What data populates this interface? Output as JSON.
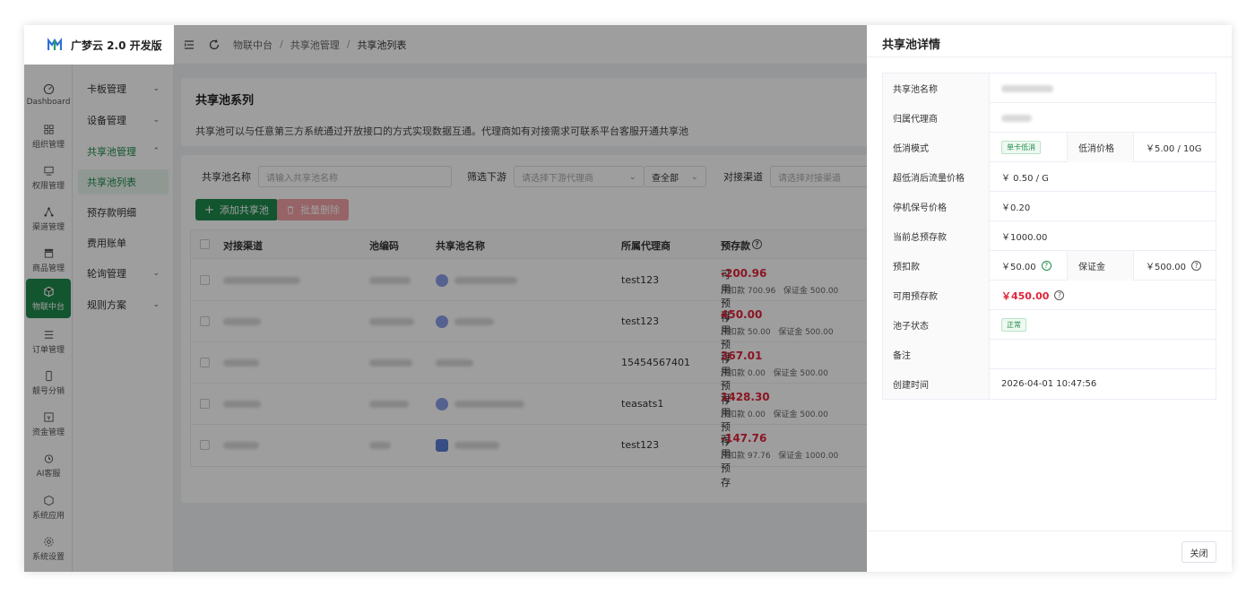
{
  "app": {
    "name": "广梦云 2.0 开发版"
  },
  "rail": [
    {
      "label": "Dashboard",
      "icon": "dashboard-icon"
    },
    {
      "label": "组织管理",
      "icon": "grid-icon"
    },
    {
      "label": "权限管理",
      "icon": "monitor-icon"
    },
    {
      "label": "渠道管理",
      "icon": "network-icon"
    },
    {
      "label": "商品管理",
      "icon": "store-icon"
    },
    {
      "label": "物联中台",
      "icon": "cube-icon",
      "active": true
    },
    {
      "label": "订单管理",
      "icon": "list-icon"
    },
    {
      "label": "靓号分销",
      "icon": "phone-icon"
    },
    {
      "label": "资金管理",
      "icon": "money-icon"
    },
    {
      "label": "AI客服",
      "icon": "clock-icon"
    },
    {
      "label": "系统应用",
      "icon": "box-icon"
    },
    {
      "label": "系统设置",
      "icon": "gear-icon"
    }
  ],
  "submenu": [
    {
      "label": "卡板管理",
      "chev": "⌄"
    },
    {
      "label": "设备管理",
      "chev": "⌄"
    },
    {
      "label": "共享池管理",
      "chev": "⌃"
    },
    {
      "label": "共享池列表",
      "chev": ""
    },
    {
      "label": "预存款明细",
      "chev": ""
    },
    {
      "label": "费用账单",
      "chev": ""
    },
    {
      "label": "轮询管理",
      "chev": "⌄"
    },
    {
      "label": "规则方案",
      "chev": "⌄"
    }
  ],
  "breadcrumb": [
    "物联中台",
    "共享池管理",
    "共享池列表"
  ],
  "page": {
    "title": "共享池系列",
    "desc": "共享池可以与任意第三方系统通过开放接口的方式实现数据互通。代理商如有对接需求可联系平台客服开通共享池"
  },
  "filters": {
    "name_label": "共享池名称",
    "name_placeholder": "请输入共享池名称",
    "downstream_label": "筛选下游",
    "downstream_placeholder": "请选择下游代理商",
    "scope_value": "查全部",
    "channel_label": "对接渠道",
    "channel_placeholder": "请选择对接渠道"
  },
  "actions": {
    "add": "添加共享池",
    "delete": "批量删除"
  },
  "table": {
    "headers": [
      "对接渠道",
      "池编码",
      "共享池名称",
      "所属代理商",
      "预存款"
    ],
    "rows": [
      {
        "agent": "test123",
        "avail_label": "可用预存",
        "avail": "-200.96",
        "sub": "预扣款 700.96   保证金 500.00",
        "dot": true
      },
      {
        "agent": "test123",
        "avail_label": "可用预存",
        "avail": "450.00",
        "sub": "预扣款 50.00   保证金 500.00",
        "dot": true
      },
      {
        "agent": "15454567401",
        "avail_label": "可用预存",
        "avail": "367.01",
        "sub": "预扣款 0.00   保证金 500.00",
        "dot": false
      },
      {
        "agent": "teasats1",
        "avail_label": "可用预存",
        "avail": "1428.30",
        "sub": "预扣款 0.00   保证金 500.00",
        "dot": true
      },
      {
        "agent": "test123",
        "avail_label": "可用预存",
        "avail": "-147.76",
        "sub": "预扣款 97.76   保证金 1000.00",
        "dot": true
      }
    ]
  },
  "drawer": {
    "title": "共享池详情",
    "rows": {
      "name_label": "共享池名称",
      "agent_label": "归属代理商",
      "lowmode_label": "低消模式",
      "lowmode_value": "单卡低消",
      "lowprice_label": "低消价格",
      "lowprice_value": "￥5.00 / 10G",
      "overflow_label": "超低消后流量价格",
      "overflow_value": "￥ 0.50 / G",
      "suspend_label": "停机保号价格",
      "suspend_value": "￥0.20",
      "total_label": "当前总预存款",
      "total_value": "￥1000.00",
      "prededuct_label": "预扣款",
      "prededuct_value": "￥50.00",
      "deposit_label": "保证金",
      "deposit_value": "￥500.00",
      "avail_label": "可用预存款",
      "avail_value": "￥450.00",
      "status_label": "池子状态",
      "status_value": "正常",
      "remark_label": "备注",
      "remark_value": "",
      "created_label": "创建时间",
      "created_value": "2026-04-01 10:47:56"
    },
    "close": "关闭"
  },
  "colors": {
    "primary": "#1f8a4c",
    "danger": "#e0243b"
  }
}
